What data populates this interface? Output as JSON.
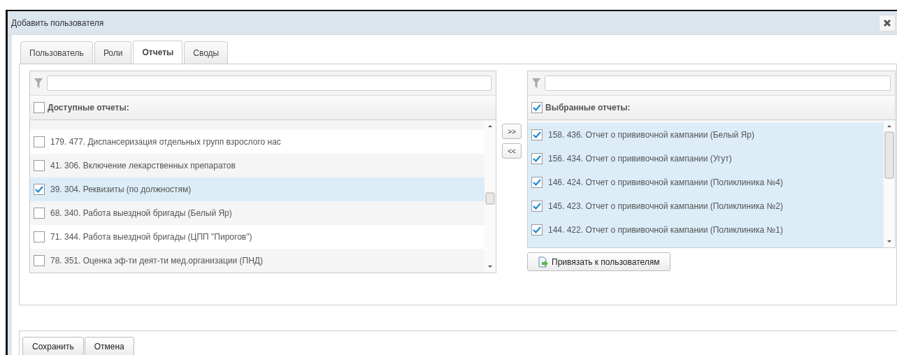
{
  "window": {
    "title": "Добавить пользователя"
  },
  "tabs": [
    {
      "label": "Пользователь",
      "selected": false
    },
    {
      "label": "Роли",
      "selected": false
    },
    {
      "label": "Отчеты",
      "selected": true
    },
    {
      "label": "Своды",
      "selected": false
    }
  ],
  "available": {
    "header": "Доступные отчеты:",
    "checked": false,
    "items": [
      {
        "label": "179. 477. Диспансеризация отдельных групп взрослого нас",
        "checked": false
      },
      {
        "label": "41. 306. Включение лекарственных препаратов",
        "checked": false
      },
      {
        "label": "39. 304. Реквизиты (по должностям)",
        "checked": true
      },
      {
        "label": "68. 340. Работа выездной бригады (Белый Яр)",
        "checked": false
      },
      {
        "label": "71. 344. Работа выездной бригады (ЦПП \"Пирогов\")",
        "checked": false
      },
      {
        "label": "78. 351. Оценка эф-ти деят-ти мед.организации (ПНД)",
        "checked": false
      }
    ]
  },
  "move_buttons": [
    ">>",
    "<<"
  ],
  "selected": {
    "header": "Выбранные отчеты:",
    "checked": true,
    "items": [
      {
        "label": "158. 436. Отчет о прививочной кампании (Белый Яр)",
        "checked": true
      },
      {
        "label": "156. 434. Отчет о прививочной кампании (Угут)",
        "checked": true
      },
      {
        "label": "146. 424. Отчет о прививочной кампании (Поликлиника №4)",
        "checked": true
      },
      {
        "label": "145. 423. Отчет о прививочной кампании (Поликлиника №2)",
        "checked": true
      },
      {
        "label": "144. 422. Отчет о прививочной кампании (Поликлиника №1)",
        "checked": true
      }
    ]
  },
  "bind_button": "Привязать к пользователям",
  "footer_buttons": [
    "Сохранить",
    "Отмена"
  ]
}
